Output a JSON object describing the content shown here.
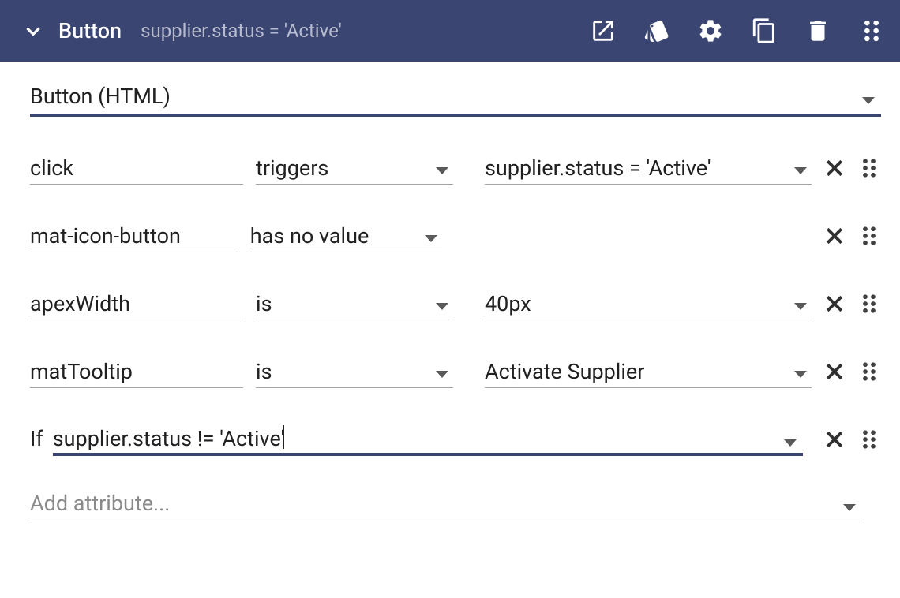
{
  "header": {
    "title": "Button",
    "subtitle": "supplier.status = 'Active'"
  },
  "elementType": "Button (HTML)",
  "rows": [
    {
      "name": "click",
      "op": "triggers",
      "value": "supplier.status = 'Active'",
      "hasValue": true
    },
    {
      "name": "mat-icon-button",
      "op": "has no value",
      "value": "",
      "hasValue": false
    },
    {
      "name": "apexWidth",
      "op": "is",
      "value": "40px",
      "hasValue": true
    },
    {
      "name": "matTooltip",
      "op": "is",
      "value": "Activate Supplier",
      "hasValue": true
    }
  ],
  "condition": {
    "prefix": "If",
    "expression": "supplier.status != 'Active'"
  },
  "addAttributePlaceholder": "Add attribute..."
}
